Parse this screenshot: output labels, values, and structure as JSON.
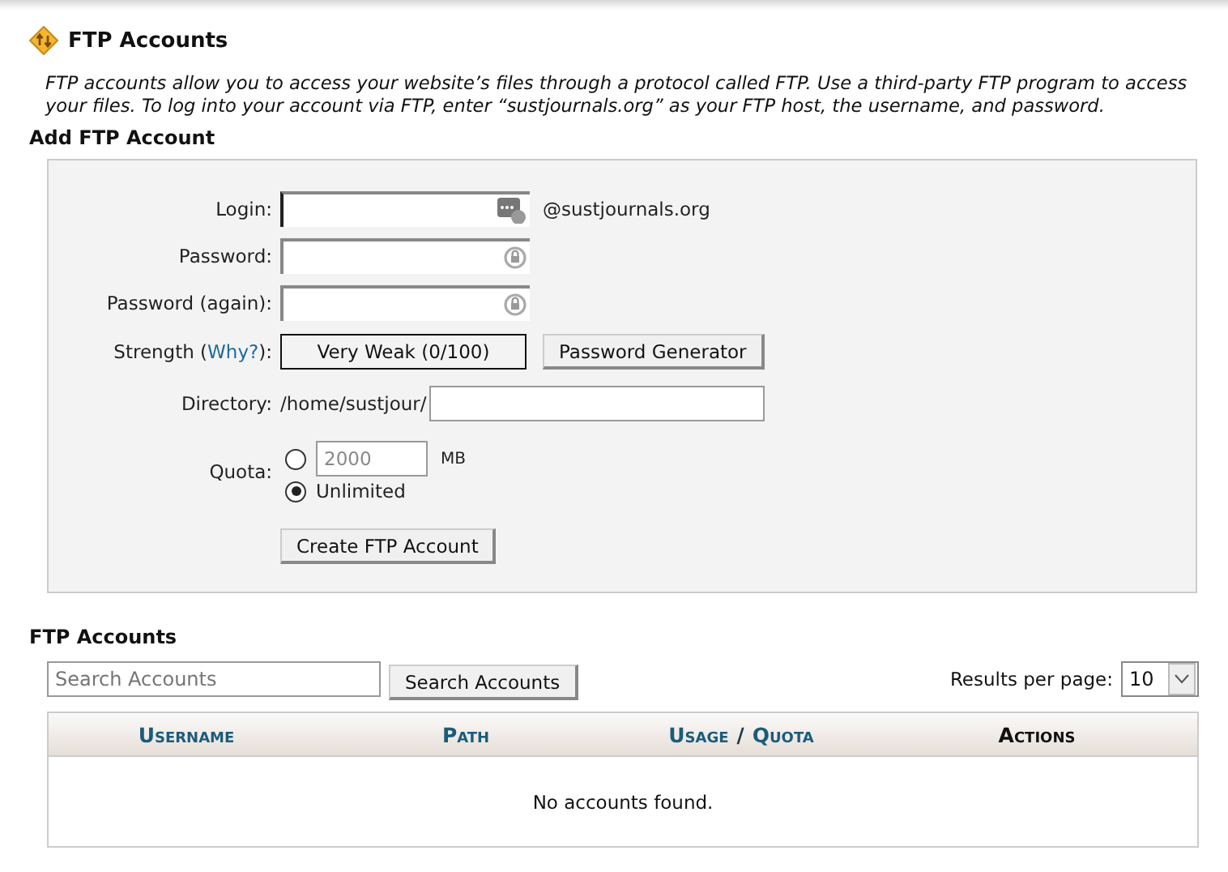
{
  "title": "FTP Accounts",
  "description": "FTP accounts allow you to access your website’s files through a protocol called FTP. Use a third-party FTP program to access your files. To log into your account via FTP, enter “sustjournals.org” as your FTP host, the username, and password.",
  "add_form": {
    "heading": "Add FTP Account",
    "login": {
      "label": "Login:",
      "suffix": "@sustjournals.org"
    },
    "password": {
      "label": "Password:"
    },
    "password_again": {
      "label": "Password (again):"
    },
    "strength": {
      "label_parts": [
        "Strength (",
        "Why?",
        "):"
      ],
      "meter": "Very Weak (0/100)",
      "generator_button": "Password Generator"
    },
    "directory": {
      "label": "Directory:",
      "prefix": "/home/sustjour/"
    },
    "quota": {
      "label": "Quota:",
      "options": [
        {
          "kind": "limit",
          "value": "2000",
          "unit": "MB",
          "selected": false
        },
        {
          "kind": "unlimited",
          "label": "Unlimited",
          "selected": true
        }
      ]
    },
    "submit": "Create FTP Account"
  },
  "accounts": {
    "heading": "FTP Accounts",
    "search": {
      "placeholder": "Search Accounts",
      "button": "Search Accounts"
    },
    "per_page": {
      "label": "Results per page:",
      "value": "10"
    },
    "columns": [
      {
        "kind": "link",
        "label": "Username"
      },
      {
        "kind": "link",
        "label": "Path"
      },
      {
        "kind": "pair",
        "labels": [
          "Usage",
          "Quota"
        ],
        "separator": "/"
      },
      {
        "kind": "plain",
        "label": "Actions"
      }
    ],
    "empty_message": "No accounts found."
  }
}
